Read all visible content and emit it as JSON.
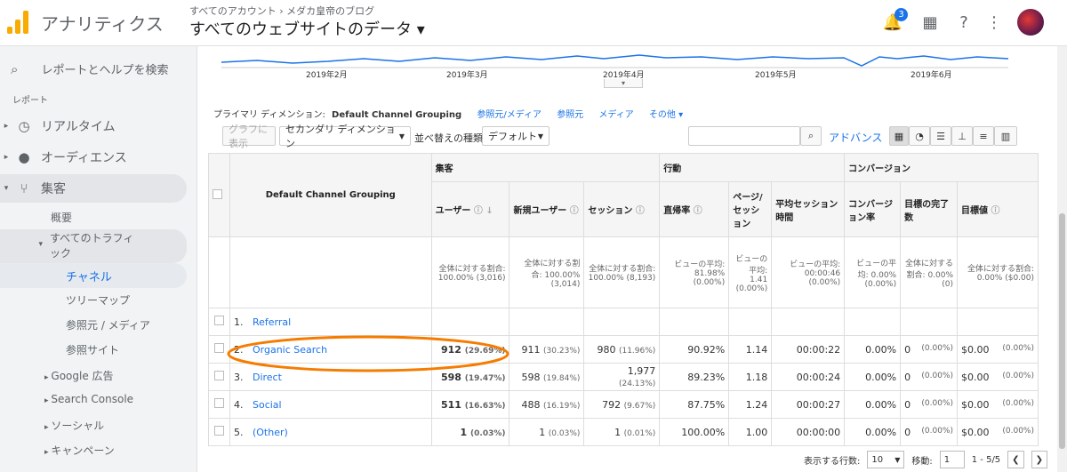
{
  "header": {
    "app_name": "アナリティクス",
    "breadcrumb": "すべてのアカウント › メダカ皇帝のブログ",
    "property": "すべてのウェブサイトのデータ ▾",
    "notification_count": "3"
  },
  "sidebar": {
    "search_label": "レポートとヘルプを検索",
    "section_label": "レポート",
    "items": [
      {
        "label": "リアルタイム",
        "icon": "clock-icon"
      },
      {
        "label": "オーディエンス",
        "icon": "person-icon"
      },
      {
        "label": "集客",
        "icon": "acquisition-icon"
      }
    ],
    "sub_items": {
      "overview": "概要",
      "all_traffic": "すべてのトラフィック",
      "channels": "チャネル",
      "treemap": "ツリーマップ",
      "source_medium": "参照元 / メディア",
      "referral_sites": "参照サイト",
      "google_ads": "Google 広告",
      "search_console": "Search Console",
      "social": "ソーシャル",
      "campaigns": "キャンペーン"
    }
  },
  "chart": {
    "x_labels": [
      "2019年2月",
      "2019年3月",
      "2019年4月",
      "2019年5月",
      "2019年6月"
    ],
    "line_color": "#1a73e8"
  },
  "dimension": {
    "primary_label": "プライマリ ディメンション:",
    "current": "Default Channel Grouping",
    "others": [
      "参照元/メディア",
      "参照元",
      "メディア",
      "その他"
    ]
  },
  "toolbar": {
    "graph_btn": "グラフに表示",
    "secondary_dim": "セカンダリ ディメンション",
    "sort_label": "並べ替えの種類:",
    "sort_value": "デフォルト",
    "advanced": "アドバンス"
  },
  "table": {
    "col_dim": "Default Channel Grouping",
    "groups": {
      "acq": "集客",
      "beh": "行動",
      "conv": "コンバージョン"
    },
    "cols": {
      "users": "ユーザー",
      "new_users": "新規ユーザー",
      "sessions": "セッション",
      "bounce": "直帰率",
      "pages": "ページ/セッション",
      "duration": "平均セッション時間",
      "conv_rate": "コンバージョン率",
      "goal_comp": "目標の完了数",
      "goal_value": "目標値"
    },
    "totals": {
      "users": "全体に対する割合: 100.00% (3,016)",
      "new_users": "全体に対する割合: 100.00% (3,014)",
      "sessions": "全体に対する割合: 100.00% (8,193)",
      "bounce": "ビューの平均: 81.98% (0.00%)",
      "pages": "ビューの平均: 1.41 (0.00%)",
      "duration": "ビューの平均: 00:00:46 (0.00%)",
      "conv_rate": "ビューの平均: 0.00% (0.00%)",
      "goal_comp": "全体に対する割合: 0.00% (0)",
      "goal_value": "全体に対する割合: 0.00% ($0.00)"
    },
    "rows": [
      {
        "idx": "1.",
        "name": "Referral",
        "users": "",
        "users_pct": "",
        "new": "",
        "new_pct": "",
        "ses": "",
        "ses_pct": "",
        "bounce": "",
        "pages": "",
        "dur": "",
        "cr": "",
        "gc": "",
        "gc_pct": "",
        "gv": "",
        "gv_pct": ""
      },
      {
        "idx": "2.",
        "name": "Organic Search",
        "users": "912",
        "users_pct": "(29.69%)",
        "new": "911",
        "new_pct": "(30.23%)",
        "ses": "980",
        "ses_pct": "(11.96%)",
        "bounce": "90.92%",
        "pages": "1.14",
        "dur": "00:00:22",
        "cr": "0.00%",
        "gc": "0",
        "gc_pct": "(0.00%)",
        "gv": "$0.00",
        "gv_pct": "(0.00%)"
      },
      {
        "idx": "3.",
        "name": "Direct",
        "users": "598",
        "users_pct": "(19.47%)",
        "new": "598",
        "new_pct": "(19.84%)",
        "ses": "1,977",
        "ses_pct": "(24.13%)",
        "bounce": "89.23%",
        "pages": "1.18",
        "dur": "00:00:24",
        "cr": "0.00%",
        "gc": "0",
        "gc_pct": "(0.00%)",
        "gv": "$0.00",
        "gv_pct": "(0.00%)"
      },
      {
        "idx": "4.",
        "name": "Social",
        "users": "511",
        "users_pct": "(16.63%)",
        "new": "488",
        "new_pct": "(16.19%)",
        "ses": "792",
        "ses_pct": "(9.67%)",
        "bounce": "87.75%",
        "pages": "1.24",
        "dur": "00:00:27",
        "cr": "0.00%",
        "gc": "0",
        "gc_pct": "(0.00%)",
        "gv": "$0.00",
        "gv_pct": "(0.00%)"
      },
      {
        "idx": "5.",
        "name": "(Other)",
        "users": "1",
        "users_pct": "(0.03%)",
        "new": "1",
        "new_pct": "(0.03%)",
        "ses": "1",
        "ses_pct": "(0.01%)",
        "bounce": "100.00%",
        "pages": "1.00",
        "dur": "00:00:00",
        "cr": "0.00%",
        "gc": "0",
        "gc_pct": "(0.00%)",
        "gv": "$0.00",
        "gv_pct": "(0.00%)"
      }
    ]
  },
  "footer": {
    "rows_label": "表示する行数:",
    "rows_value": "10",
    "goto_label": "移動:",
    "goto_value": "1",
    "range": "1 - 5/5"
  },
  "colors": {
    "accent": "#1a73e8",
    "highlight": "#f57c00"
  }
}
